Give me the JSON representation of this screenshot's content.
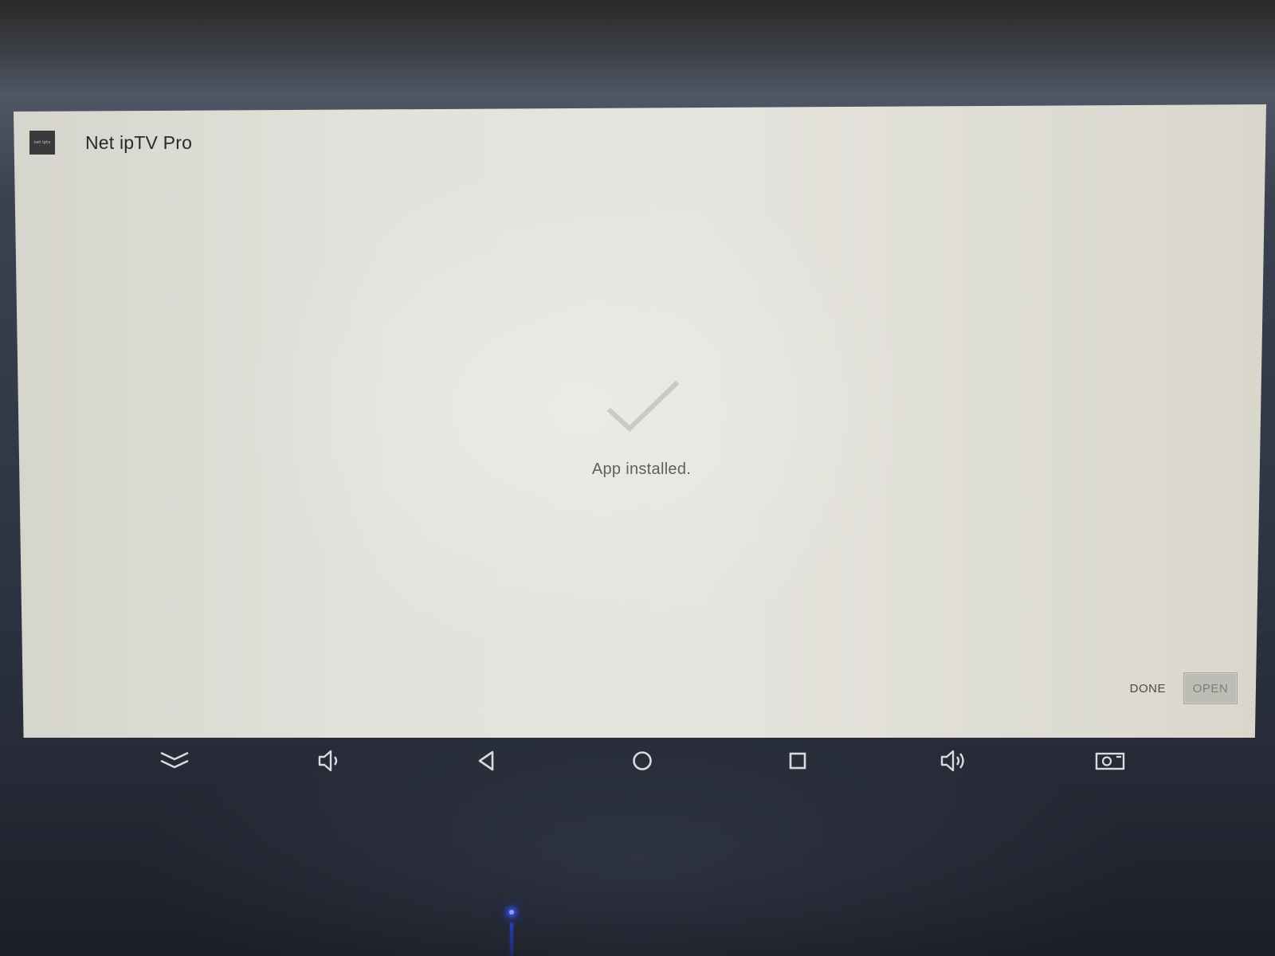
{
  "app": {
    "title": "Net ipTV Pro",
    "icon_text": "net iptv"
  },
  "status": {
    "message": "App installed.",
    "icon": "checkmark-icon"
  },
  "actions": {
    "done_label": "DONE",
    "open_label": "OPEN"
  },
  "navbar": {
    "items": [
      {
        "name": "hide-navbar",
        "icon": "double-chevron-down-icon"
      },
      {
        "name": "volume-down",
        "icon": "volume-down-icon"
      },
      {
        "name": "back",
        "icon": "back-triangle-icon"
      },
      {
        "name": "home",
        "icon": "home-circle-icon"
      },
      {
        "name": "recents",
        "icon": "recents-square-icon"
      },
      {
        "name": "volume-up",
        "icon": "volume-up-icon"
      },
      {
        "name": "screenshot",
        "icon": "screenshot-icon"
      }
    ]
  },
  "colors": {
    "dialog_background": "#e3e2dc",
    "title_text": "#2a2a2a",
    "status_text": "#606060",
    "checkmark": "#c9c9c9",
    "open_button_bg": "#bebdb5",
    "navbar_icon": "#d8dbe2",
    "led": "#3a5bff"
  }
}
